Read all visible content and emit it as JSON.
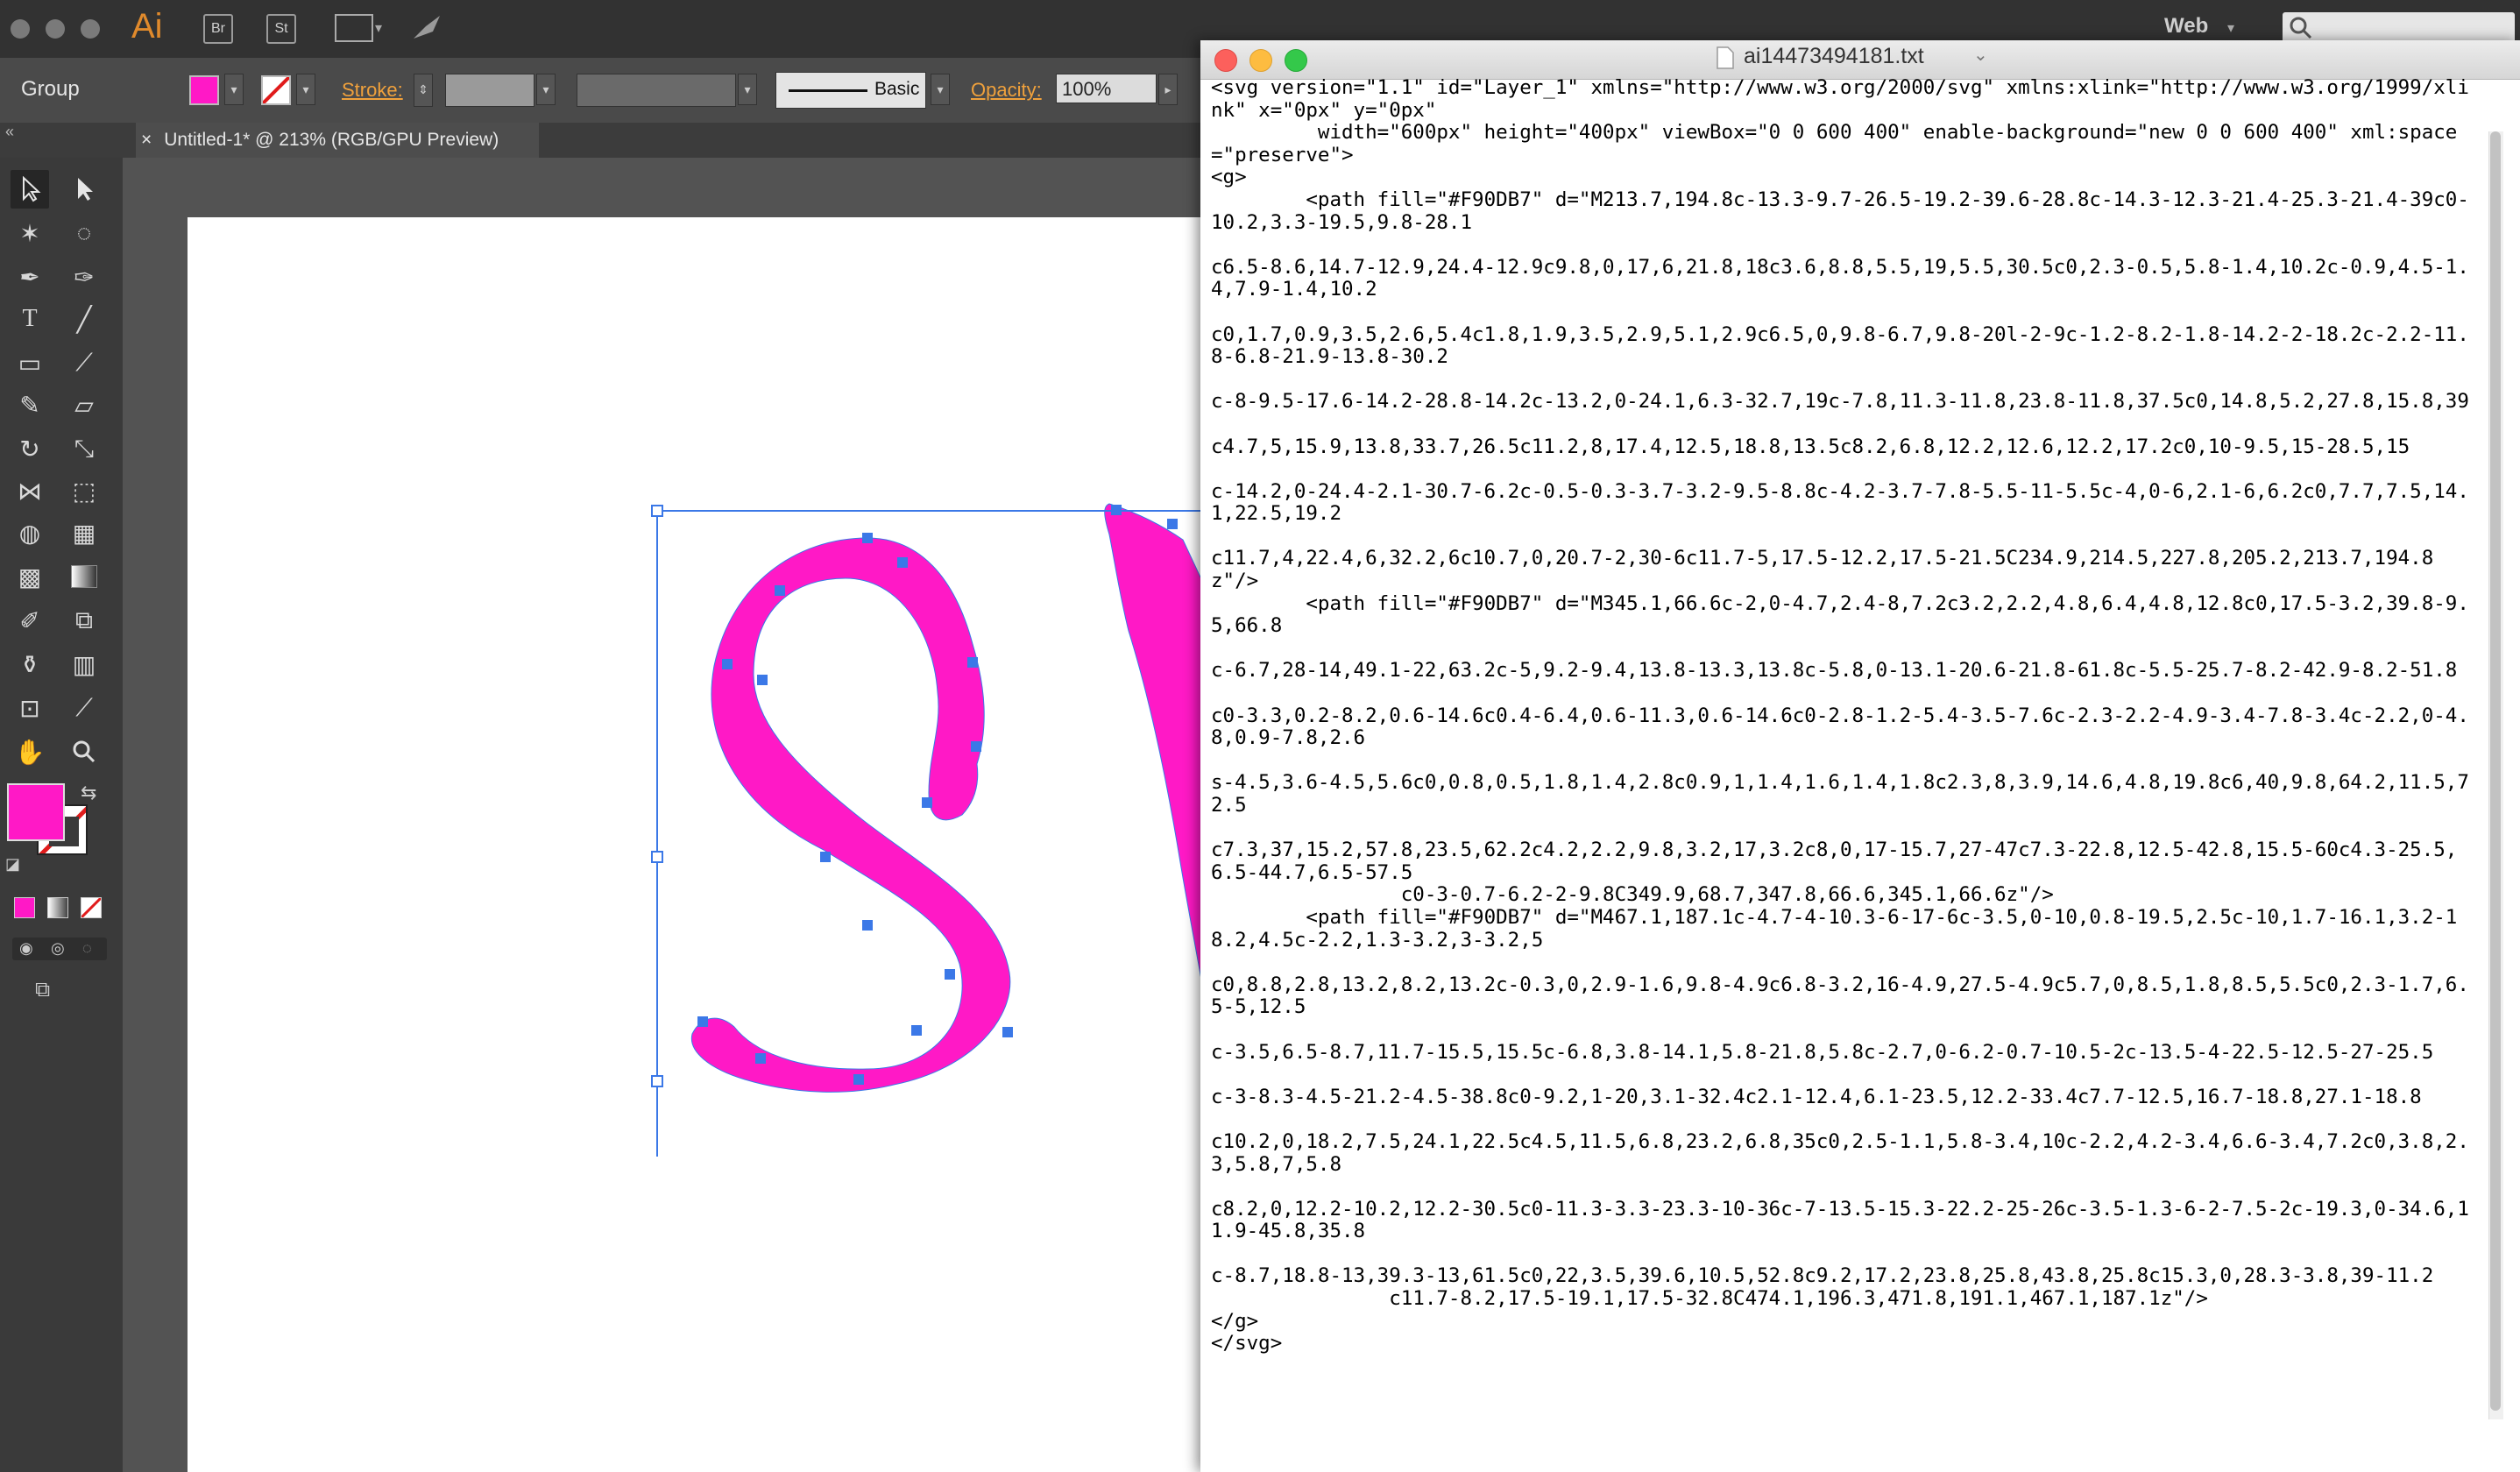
{
  "app": {
    "logo": "Ai",
    "bridge": "Br",
    "stock": "St",
    "workspace": "Web"
  },
  "control": {
    "selection": "Group",
    "stroke_label": "Stroke:",
    "brush_label": "Basic",
    "opacity_label": "Opacity:",
    "opacity_value": "100%",
    "fill_color": "#FF19C6"
  },
  "document": {
    "tab_title": "Untitled-1* @ 213% (RGB/GPU Preview)",
    "close": "×"
  },
  "editor": {
    "title": "ai14473494181.txt",
    "content": "<svg version=\"1.1\" id=\"Layer_1\" xmlns=\"http://www.w3.org/2000/svg\" xmlns:xlink=\"http://www.w3.org/1999/xlink\" x=\"0px\" y=\"0px\"\n         width=\"600px\" height=\"400px\" viewBox=\"0 0 600 400\" enable-background=\"new 0 0 600 400\" xml:space=\"preserve\">\n<g>\n        <path fill=\"#F90DB7\" d=\"M213.7,194.8c-13.3-9.7-26.5-19.2-39.6-28.8c-14.3-12.3-21.4-25.3-21.4-39c0-10.2,3.3-19.5,9.8-28.1\n\nc6.5-8.6,14.7-12.9,24.4-12.9c9.8,0,17,6,21.8,18c3.6,8.8,5.5,19,5.5,30.5c0,2.3-0.5,5.8-1.4,10.2c-0.9,4.5-1.4,7.9-1.4,10.2\n\nc0,1.7,0.9,3.5,2.6,5.4c1.8,1.9,3.5,2.9,5.1,2.9c6.5,0,9.8-6.7,9.8-20l-2-9c-1.2-8.2-1.8-14.2-2-18.2c-2.2-11.8-6.8-21.9-13.8-30.2\n\nc-8-9.5-17.6-14.2-28.8-14.2c-13.2,0-24.1,6.3-32.7,19c-7.8,11.3-11.8,23.8-11.8,37.5c0,14.8,5.2,27.8,15.8,39\n\nc4.7,5,15.9,13.8,33.7,26.5c11.2,8,17.4,12.5,18.8,13.5c8.2,6.8,12.2,12.6,12.2,17.2c0,10-9.5,15-28.5,15\n\nc-14.2,0-24.4-2.1-30.7-6.2c-0.5-0.3-3.7-3.2-9.5-8.8c-4.2-3.7-7.8-5.5-11-5.5c-4,0-6,2.1-6,6.2c0,7.7,7.5,14.1,22.5,19.2\n\nc11.7,4,22.4,6,32.2,6c10.7,0,20.7-2,30-6c11.7-5,17.5-12.2,17.5-21.5C234.9,214.5,227.8,205.2,213.7,194.8\nz\"/>\n        <path fill=\"#F90DB7\" d=\"M345.1,66.6c-2,0-4.7,2.4-8,7.2c3.2,2.2,4.8,6.4,4.8,12.8c0,17.5-3.2,39.8-9.5,66.8\n\nc-6.7,28-14,49.1-22,63.2c-5,9.2-9.4,13.8-13.3,13.8c-5.8,0-13.1-20.6-21.8-61.8c-5.5-25.7-8.2-42.9-8.2-51.8\n\nc0-3.3,0.2-8.2,0.6-14.6c0.4-6.4,0.6-11.3,0.6-14.6c0-2.8-1.2-5.4-3.5-7.6c-2.3-2.2-4.9-3.4-7.8-3.4c-2.2,0-4.8,0.9-7.8,2.6\n\ns-4.5,3.6-4.5,5.6c0,0.8,0.5,1.8,1.4,2.8c0.9,1,1.4,1.6,1.4,1.8c2.3,8,3.9,14.6,4.8,19.8c6,40,9.8,64.2,11.5,72.5\n\nc7.3,37,15.2,57.8,23.5,62.2c4.2,2.2,9.8,3.2,17,3.2c8,0,17-15.7,27-47c7.3-22.8,12.5-42.8,15.5-60c4.3-25.5,6.5-44.7,6.5-57.5\n                c0-3-0.7-6.2-2-9.8C349.9,68.7,347.8,66.6,345.1,66.6z\"/>\n        <path fill=\"#F90DB7\" d=\"M467.1,187.1c-4.7-4-10.3-6-17-6c-3.5,0-10,0.8-19.5,2.5c-10,1.7-16.1,3.2-18.2,4.5c-2.2,1.3-3.2,3-3.2,5\n\nc0,8.8,2.8,13.2,8.2,13.2c-0.3,0,2.9-1.6,9.8-4.9c6.8-3.2,16-4.9,27.5-4.9c5.7,0,8.5,1.8,8.5,5.5c0,2.3-1.7,6.5-5,12.5\n\nc-3.5,6.5-8.7,11.7-15.5,15.5c-6.8,3.8-14.1,5.8-21.8,5.8c-2.7,0-6.2-0.7-10.5-2c-13.5-4-22.5-12.5-27-25.5\n\nc-3-8.3-4.5-21.2-4.5-38.8c0-9.2,1-20,3.1-32.4c2.1-12.4,6.1-23.5,12.2-33.4c7.7-12.5,16.7-18.8,27.1-18.8\n\nc10.2,0,18.2,7.5,24.1,22.5c4.5,11.5,6.8,23.2,6.8,35c0,2.5-1.1,5.8-3.4,10c-2.2,4.2-3.4,6.6-3.4,7.2c0,3.8,2.3,5.8,7,5.8\n\nc8.2,0,12.2-10.2,12.2-30.5c0-11.3-3.3-23.3-10-36c-7-13.5-15.3-22.2-25-26c-3.5-1.3-6-2-7.5-2c-19.3,0-34.6,11.9-45.8,35.8\n\nc-8.7,18.8-13,39.3-13,61.5c0,22,3.5,39.6,10.5,52.8c9.2,17.2,23.8,25.8,43.8,25.8c15.3,0,28.3-3.8,39-11.2\n               c11.7-8.2,17.5-19.1,17.5-32.8C474.1,196.3,471.8,191.1,467.1,187.1z\"/>\n</g>\n</svg>"
  }
}
